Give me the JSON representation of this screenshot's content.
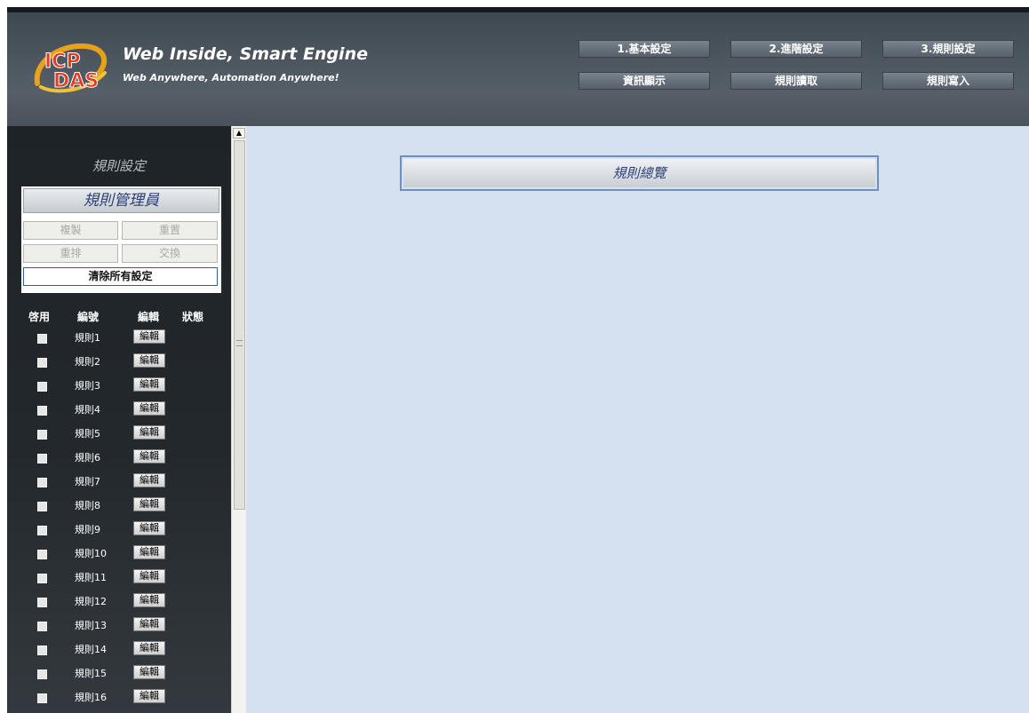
{
  "header": {
    "brand": "ICP DAS",
    "tagline": "Web Inside, Smart Engine",
    "subtagline": "Web Anywhere, Automation Anywhere!",
    "nav": [
      "1.基本設定",
      "2.進階設定",
      "3.規則設定",
      "資訊顯示",
      "規則讀取",
      "規則寫入"
    ]
  },
  "sidebar": {
    "title": "規則設定",
    "manager_title": "規則管理員",
    "buttons": {
      "copy": "複製",
      "reset": "重置",
      "reorder": "重排",
      "swap": "交換",
      "clear_all": "清除所有設定"
    },
    "columns": {
      "enable": "啓用",
      "number": "編號",
      "edit": "編輯",
      "status": "狀態"
    },
    "edit_label": "編輯",
    "rules": [
      "規則1",
      "規則2",
      "規則3",
      "規則4",
      "規則5",
      "規則6",
      "規則7",
      "規則8",
      "規則9",
      "規則10",
      "規則11",
      "規則12",
      "規則13",
      "規則14",
      "規則15",
      "規則16"
    ]
  },
  "main": {
    "overview_title": "規則總覽"
  },
  "colors": {
    "header_bg": "#4b545d",
    "sidebar_bg": "#23282c",
    "main_bg": "#d5e1f0",
    "title_text": "#2c3f73"
  }
}
